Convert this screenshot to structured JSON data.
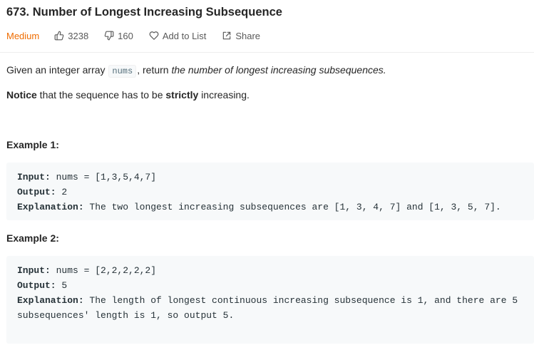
{
  "problem": {
    "title": "673. Number of Longest Increasing Subsequence",
    "difficulty": "Medium",
    "likes": "3238",
    "dislikes": "160",
    "add_to_list": "Add to List",
    "share": "Share"
  },
  "description": {
    "p1_pre": "Given an integer array ",
    "p1_code": "nums",
    "p1_mid": ", return ",
    "p1_em": "the number of longest increasing subsequences.",
    "p2_strong1": "Notice",
    "p2_mid": " that the sequence has to be ",
    "p2_strong2": "strictly",
    "p2_end": " increasing."
  },
  "examples": [
    {
      "heading": "Example 1:",
      "input_label": "Input:",
      "input_value": " nums = [1,3,5,4,7]",
      "output_label": "Output:",
      "output_value": " 2",
      "explanation_label": "Explanation:",
      "explanation_value": " The two longest increasing subsequences are [1, 3, 4, 7] and [1, 3, 5, 7]."
    },
    {
      "heading": "Example 2:",
      "input_label": "Input:",
      "input_value": " nums = [2,2,2,2,2]",
      "output_label": "Output:",
      "output_value": " 5",
      "explanation_label": "Explanation:",
      "explanation_value": " The length of longest continuous increasing subsequence is 1, and there are 5 subsequences' length is 1, so output 5."
    }
  ],
  "icons": {
    "likes": "thumbs-up-icon",
    "dislikes": "thumbs-down-icon",
    "add_to_list": "heart-icon",
    "share": "share-icon"
  },
  "colors": {
    "difficulty_medium": "#ef6c00",
    "code_block_bg": "#f7f9fa",
    "text": "#262626",
    "meta_text": "#595959"
  }
}
